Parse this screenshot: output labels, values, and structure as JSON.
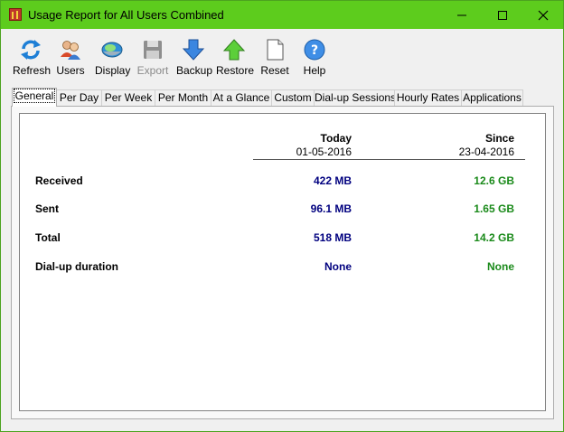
{
  "window": {
    "title": "Usage Report for All Users Combined"
  },
  "toolbar": {
    "refresh": "Refresh",
    "users": "Users",
    "display": "Display",
    "export": "Export",
    "backup": "Backup",
    "restore": "Restore",
    "reset": "Reset",
    "help": "Help"
  },
  "tabs": [
    "General",
    "Per Day",
    "Per Week",
    "Per Month",
    "At a Glance",
    "Custom",
    "Dial-up Sessions",
    "Hourly Rates",
    "Applications"
  ],
  "report": {
    "today_header": "Today",
    "today_date": "01-05-2016",
    "since_header": "Since",
    "since_date": "23-04-2016",
    "rows": [
      {
        "label": "Received",
        "today": "422 MB",
        "since": "12.6 GB"
      },
      {
        "label": "Sent",
        "today": "96.1 MB",
        "since": "1.65 GB"
      },
      {
        "label": "Total",
        "today": "518 MB",
        "since": "14.2 GB"
      },
      {
        "label": "Dial-up duration",
        "today": "None",
        "since": "None"
      }
    ]
  },
  "colors": {
    "titlebar": "#5dcc1d",
    "today_value": "#00007f",
    "since_value": "#1a8a1a"
  }
}
